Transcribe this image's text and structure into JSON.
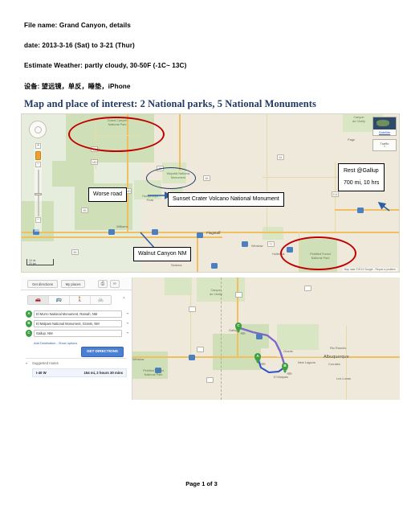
{
  "document": {
    "notes": [
      "File name: Grand Canyon, details",
      "date:  2013-3-16 (Sat) to 3-21 (Thur)",
      "Estimate Weather: partly cloudy, 30-50F (-1C~ 13C)",
      "设备: 望远镜，单反，睡垫，iPhone"
    ],
    "section_title": "Map and place of interest:  2 National parks, 5 National Monuments",
    "footer": "Page 1 of 3",
    "accent_color": "#1f3864",
    "highlight_color": "#c00000"
  },
  "map_overview": {
    "callouts": [
      {
        "text": "Worse road"
      },
      {
        "text": "Sunset Crater Volcano National Monument"
      },
      {
        "text": "Walnut Canyon NM"
      }
    ],
    "rest_callout": {
      "line1": "Rest @Gallup",
      "line2": "700 mi, 10 hrs"
    },
    "park_labels": [
      "Grand Canyon\nNational Park",
      "Wupatki National\nMonument",
      "Petrified Forest\nNational Park",
      "Humphreys\nPeak",
      "Canyon\nde Chelly"
    ],
    "city_labels": [
      "Flagstaff",
      "Williams",
      "Winslow",
      "Holbrook",
      "Sedona",
      "Page"
    ],
    "controls": {
      "satellite_label": "Satellite",
      "traffic_label": "Traffic",
      "scale_miles": "10 mi",
      "scale_km": "20 km",
      "attribution": "Map data ©2013 Google  -  Report a problem"
    },
    "highways": [
      "89",
      "180",
      "64",
      "67",
      "17",
      "40",
      "66",
      "180",
      "87",
      "77",
      "191"
    ]
  },
  "map_directions": {
    "tabs": [
      {
        "label": "Get directions",
        "active": true
      },
      {
        "label": "My places",
        "active": false
      }
    ],
    "toolbar_icons": [
      {
        "name": "print-icon",
        "glyph": "⎙"
      },
      {
        "name": "link-icon",
        "glyph": "∞"
      }
    ],
    "travel_modes": [
      {
        "name": "car-mode",
        "glyph": "🚗",
        "active": true
      },
      {
        "name": "transit-mode",
        "glyph": "🚌",
        "active": false
      },
      {
        "name": "walk-mode",
        "glyph": "🚶",
        "active": false
      },
      {
        "name": "bike-mode",
        "glyph": "🚲",
        "active": false
      }
    ],
    "close_label": "×",
    "waypoints": [
      {
        "letter": "A",
        "value": "El Morro National Monument, Ramah, NM"
      },
      {
        "letter": "B",
        "value": "El Malpais National Monument, Grants, NM"
      },
      {
        "letter": "C",
        "value": "Gallup, NM"
      }
    ],
    "add_destination_label": "Add Destination",
    "show_options_label": "Show options",
    "links_separator": " - ",
    "get_directions_button": "GET DIRECTIONS",
    "suggested_routes_label": "Suggested routes",
    "route": {
      "name": "I-40 W",
      "summary": "154 mi, 2 hours 30 mins"
    },
    "map_labels": {
      "cities": [
        "Albuquerque",
        "Rio Rancho",
        "Grants",
        "New Laguna",
        "Los Lunas",
        "El Malpais",
        "Corrales",
        "Winslow",
        "Gallup"
      ],
      "parks": [
        "Canyon\nde Chelly",
        "Petrified Forest\nNational Park"
      ],
      "highways": [
        "191",
        "264",
        "602",
        "60",
        "40",
        "25",
        "53"
      ]
    },
    "route_colors": {
      "primary": "#7b68c8",
      "secondary": "#2f52c8",
      "marker": "#3c9f40"
    }
  }
}
